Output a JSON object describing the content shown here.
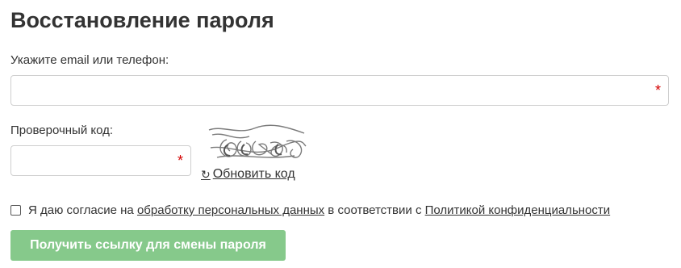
{
  "page": {
    "title": "Восстановление пароля"
  },
  "form": {
    "contact_label": "Укажите email или телефон:",
    "contact_value": "",
    "required_mark": "*",
    "code_label": "Проверочный код:",
    "code_value": "",
    "refresh_icon": "refresh-icon",
    "refresh_label": "Обновить код",
    "consent": {
      "checked": false,
      "text_before": "Я даю согласие на ",
      "link1": "обработку персональных данных",
      "text_middle": " в соответствии с ",
      "link2": "Политикой конфиденциальности"
    },
    "submit_label": "Получить ссылку для смены пароля"
  },
  "colors": {
    "text": "#333333",
    "required": "#d40000",
    "button_bg": "#86c98b",
    "button_text": "#ffffff",
    "border": "#cfcfcf"
  }
}
